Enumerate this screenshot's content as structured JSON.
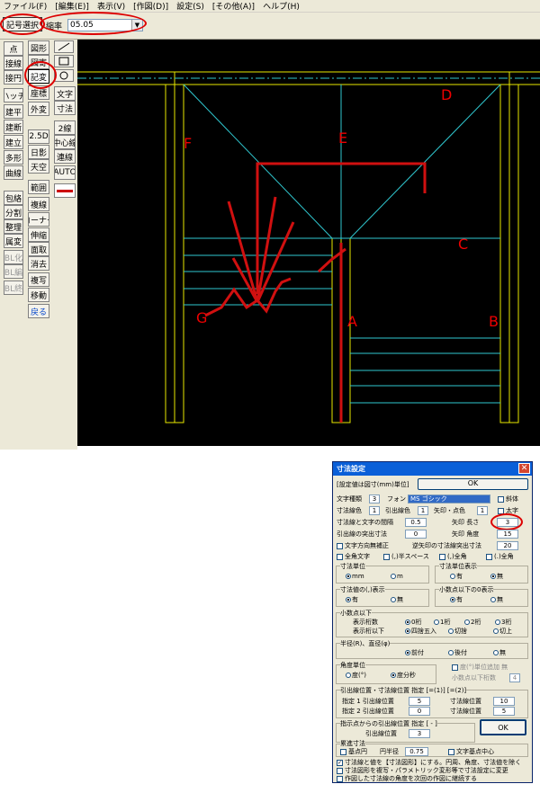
{
  "menu": [
    "ファイル(F)",
    "[編集(E)]",
    "表示(V)",
    "[作図(D)]",
    "設定(S)",
    "[その他(A)]",
    "ヘルプ(H)"
  ],
  "toolbar": {
    "symbol_select": "記号選択",
    "scale_label": "縮率",
    "scale_value": "05.05"
  },
  "left_col1": [
    "点",
    "接線",
    "接円",
    "ハッチ",
    "建平",
    "建断",
    "建立",
    "多形",
    "曲線",
    "包絡",
    "分割",
    "整理",
    "属変",
    "BL化",
    "BL編",
    "BL終"
  ],
  "left_col2": [
    "図形",
    "図寄",
    "記変",
    "座標",
    "外変",
    "2.5D",
    "日影",
    "天空",
    "範囲",
    "複線",
    "コーナー",
    "伸縮",
    "面取",
    "消去",
    "複写",
    "移動",
    "戻る"
  ],
  "left_col3": [
    "文字",
    "寸法",
    "2線",
    "中心線",
    "連線",
    "AUTO"
  ],
  "canvas_labels": [
    "D",
    "F",
    "E",
    "C",
    "A",
    "B",
    "G"
  ],
  "dialog": {
    "title": "寸法設定",
    "unit_note": "[設定値は図寸(mm)単位]",
    "ok": "OK",
    "text_type_label": "文字種類",
    "text_type": "3",
    "font_label": "フォント",
    "font": "MS ゴシック",
    "italic": "斜体",
    "bold": "太字",
    "dim_color_label": "寸法線色",
    "dim_color": "1",
    "lead_color_label": "引出線色",
    "lead_color": "1",
    "arrow_color_label": "矢印・点色",
    "arrow_color": "1",
    "gap_label": "寸法線と文字の間隔",
    "gap": "0.5",
    "arrow_len_label": "矢印 長さ",
    "arrow_len": "3",
    "lead_over_label": "引出線の突出寸法",
    "lead_over": "0",
    "arrow_angle_label": "矢印 角度",
    "arrow_angle": "15",
    "text_dir": "文字方向無補正",
    "reverse_label": "逆矢印の寸法線突出寸法",
    "reverse": "20",
    "fullwidth_text": "全角文字",
    "space": "(,)半スペース",
    "comma_full": "(,)全角",
    "period_full": "(.)全角",
    "unit_title": "寸法単位",
    "unit_mm": "mm",
    "unit_m": "m",
    "unit_disp_title": "寸法単位表示",
    "yes": "有",
    "no": "無",
    "comma_title": "寸法値の(,)表示",
    "decimal_zero_title": "小数点以下の0表示",
    "decimal_title": "小数点以下",
    "digits_label": "表示桁数",
    "d0": "0桁",
    "d1": "1桁",
    "d2": "2桁",
    "d3": "3桁",
    "round_label": "表示桁以下",
    "round": "四捨五入",
    "cut": "切捨",
    "up": "切上",
    "radius_title": "半径(R)、直径(φ)",
    "prefix": "前付",
    "suffix": "後付",
    "none": "無",
    "angle_title": "角度単位",
    "deg": "度(°)",
    "dms": "度分秒",
    "deg_suffix": "度(°)単位追加 無",
    "decimal_digits_label": "小数点以下桁数",
    "decimal_digits": "4",
    "lead_pos_title": "引出線位置・寸法線位置 指定 [=(1)] [=(2)]",
    "lead1_label": "指定 1 引出線位置",
    "lead1": "5",
    "dim1_label": "寸法線位置",
    "dim1": "10",
    "lead2_label": "指定 2 引出線位置",
    "lead2": "0",
    "dim2_label": "寸法線位置",
    "dim2": "5",
    "point_title": "指示点からの引出線位置 指定 [ - ]",
    "point_label": "引出線位置",
    "point": "3",
    "tolerance_title": "累進寸法",
    "base_circle": "基点円",
    "circle_radius_label": "円半径",
    "circle_radius": "0.75",
    "text_center": "文字基点中心",
    "opt1": "寸法線と値を【寸法図形】にする。円周、角度、寸法値を除く",
    "opt2": "寸法図形を複写・パラメトリック変形等で寸法設定に変更",
    "opt3": "作図した寸法線の角度を次回の作図に継続する"
  }
}
